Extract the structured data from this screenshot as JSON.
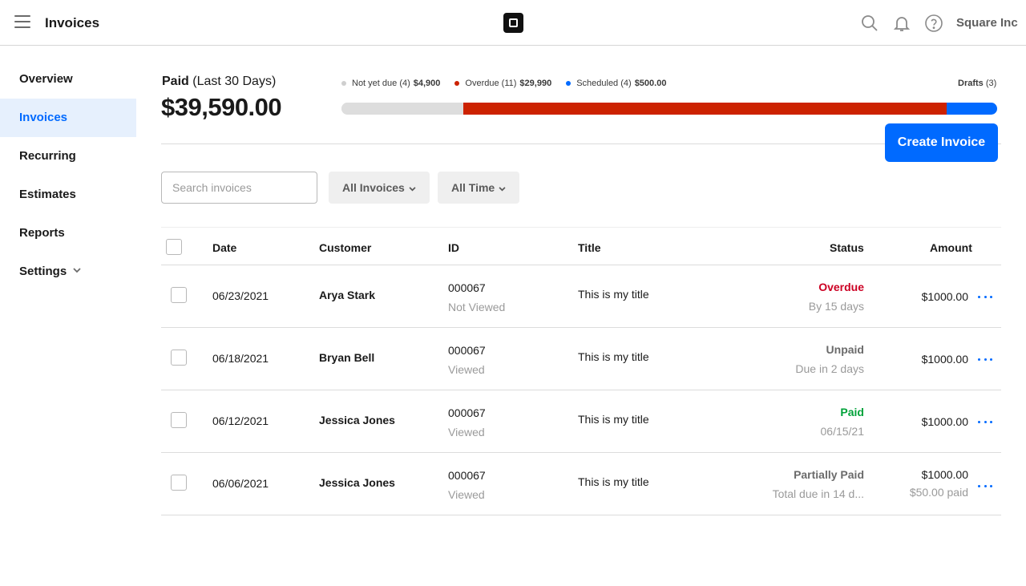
{
  "header": {
    "app_title": "Invoices",
    "account_name": "Square Inc",
    "icons": [
      "menu-icon",
      "square-logo-icon",
      "search-icon",
      "bell-icon",
      "help-icon"
    ]
  },
  "sidebar": {
    "items": [
      {
        "label": "Overview",
        "active": false
      },
      {
        "label": "Invoices",
        "active": true
      },
      {
        "label": "Recurring",
        "active": false
      },
      {
        "label": "Estimates",
        "active": false
      },
      {
        "label": "Reports",
        "active": false
      },
      {
        "label": "Settings",
        "active": false,
        "has_dropdown": true
      }
    ]
  },
  "summary": {
    "label_bold": "Paid",
    "label_rest": " (Last 30 Days)",
    "amount": "$39,590.00",
    "legend": [
      {
        "label": "Not yet due (4)",
        "amount": "$4,900",
        "color": "#cfcfcf"
      },
      {
        "label": "Overdue (11)",
        "amount": "$29,990",
        "color": "#cc2200"
      },
      {
        "label": "Scheduled (4)",
        "amount": "$500.00",
        "color": "#006aff"
      }
    ],
    "drafts_label": "Drafts",
    "drafts_count": "(3)",
    "bar": [
      {
        "name": "not-yet-due",
        "fraction": 0.186,
        "color": "#dddddd"
      },
      {
        "name": "overdue",
        "fraction": 0.737,
        "color": "#cc2200"
      },
      {
        "name": "scheduled",
        "fraction": 0.077,
        "color": "#006aff"
      }
    ]
  },
  "actions": {
    "create_invoice_label": "Create Invoice"
  },
  "filters": {
    "search_placeholder": "Search invoices",
    "invoice_filter": "All Invoices",
    "time_filter": "All Time"
  },
  "table": {
    "columns": {
      "date": "Date",
      "customer": "Customer",
      "id": "ID",
      "title": "Title",
      "status": "Status",
      "amount": "Amount"
    },
    "rows": [
      {
        "date": "06/23/2021",
        "customer": "Arya Stark",
        "id": "000067",
        "view_state": "Not Viewed",
        "title": "This is my title",
        "status": "Overdue",
        "status_color": "#cc0023",
        "status_detail": "By 15 days",
        "amount": "$1000.00",
        "amount_detail": ""
      },
      {
        "date": "06/18/2021",
        "customer": "Bryan Bell",
        "id": "000067",
        "view_state": "Viewed",
        "title": "This is my title",
        "status": "Unpaid",
        "status_color": "#6b6b6b",
        "status_detail": "Due in 2 days",
        "amount": "$1000.00",
        "amount_detail": ""
      },
      {
        "date": "06/12/2021",
        "customer": "Jessica Jones",
        "id": "000067",
        "view_state": "Viewed",
        "title": "This is my title",
        "status": "Paid",
        "status_color": "#00a23a",
        "status_detail": "06/15/21",
        "amount": "$1000.00",
        "amount_detail": ""
      },
      {
        "date": "06/06/2021",
        "customer": "Jessica Jones",
        "id": "000067",
        "view_state": "Viewed",
        "title": "This is my title",
        "status": "Partially Paid",
        "status_color": "#6b6b6b",
        "status_detail": "Total due in 14 d...",
        "amount": "$1000.00",
        "amount_detail": "$50.00 paid"
      }
    ]
  },
  "colors": {
    "accent": "#006aff",
    "overdue": "#cc2200",
    "paid": "#00a23a"
  }
}
